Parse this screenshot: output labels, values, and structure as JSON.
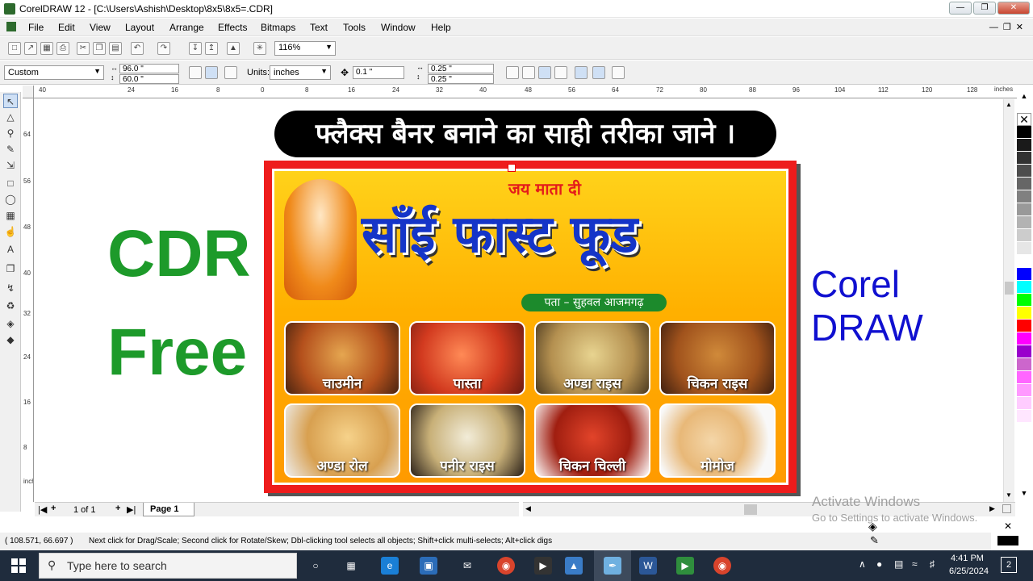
{
  "window": {
    "title": "CorelDRAW 12 - [C:\\Users\\Ashish\\Desktop\\8x5\\8x5=.CDR]"
  },
  "menu": [
    "File",
    "Edit",
    "View",
    "Layout",
    "Arrange",
    "Effects",
    "Bitmaps",
    "Text",
    "Tools",
    "Window",
    "Help"
  ],
  "toolbar": {
    "zoom": "116%"
  },
  "propbar": {
    "paper": "Custom",
    "width": "96.0 \"",
    "height": "60.0 \"",
    "units_label": "Units:",
    "units": "inches",
    "nudge": "0.1 \"",
    "dup_x": "0.25 \"",
    "dup_y": "0.25 \""
  },
  "ruler": {
    "h_ticks": [
      "40",
      "24",
      "16",
      "8",
      "0",
      "8",
      "16",
      "24",
      "32",
      "40",
      "48",
      "56",
      "64",
      "72",
      "80",
      "88",
      "96",
      "104",
      "112",
      "120",
      "128",
      "inches"
    ],
    "v_ticks": [
      "64",
      "56",
      "48",
      "40",
      "32",
      "24",
      "16",
      "8"
    ],
    "v_unit": "inches"
  },
  "canvas": {
    "headline": "फ्लैक्स बैनर बनाने का साही तरीका जाने ।",
    "left_line1": "CDR",
    "left_line2": "Free",
    "right_line1": "Corel",
    "right_line2": "DRAW",
    "banner": {
      "tagline": "जय माता दी",
      "title": "साँई फास्ट फूड",
      "address": "पता – सुहवल आजमगढ़",
      "items": [
        "चाउमीन",
        "पास्ता",
        "अण्डा राइस",
        "चिकन राइस",
        "अण्डा रोल",
        "पनीर राइस",
        "चिकन चिल्ली",
        "मोमोज"
      ]
    },
    "watermark_line1": "Activate Windows",
    "watermark_line2": "Go to Settings to activate Windows."
  },
  "pagebar": {
    "count": "1 of 1",
    "tab": "Page 1"
  },
  "status": {
    "coords": "( 108.571, 66.697 )",
    "hint": "Next click for Drag/Scale; Second click for Rotate/Skew; Dbl-clicking tool selects all objects; Shift+click multi-selects; Alt+click digs"
  },
  "taskbar": {
    "search_placeholder": "Type here to search",
    "time": "4:41 PM",
    "date": "6/25/2024",
    "notifications": "2"
  },
  "colors": {
    "palette": [
      "#000000",
      "#1a1a1a",
      "#333333",
      "#4d4d4d",
      "#666666",
      "#808080",
      "#999999",
      "#b3b3b3",
      "#cccccc",
      "#e6e6e6",
      "#ffffff",
      "#0000ff",
      "#00ffff",
      "#00ff00",
      "#ffff00",
      "#ff0000",
      "#ff00ff",
      "#9900cc",
      "#cc66cc",
      "#ff66ff",
      "#ff99ff",
      "#ffccff",
      "#ffe6ff",
      "#ffffff"
    ]
  }
}
